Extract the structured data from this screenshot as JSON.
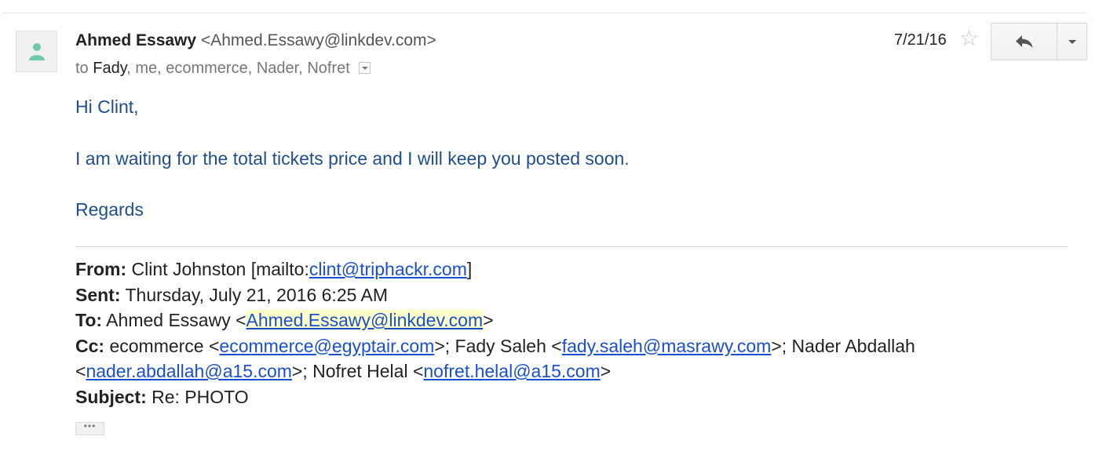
{
  "sender": {
    "name": "Ahmed Essawy",
    "email": "<Ahmed.Essawy@linkdev.com>"
  },
  "recipients": {
    "prefix": "to",
    "first": "Fady",
    "rest": ", me, ecommerce, Nader, Nofret"
  },
  "date": "7/21/16",
  "icons": {
    "avatar": "person-icon",
    "star": "star-icon",
    "reply": "reply-icon",
    "more": "chevron-down-icon"
  },
  "body": {
    "greeting": "Hi Clint,",
    "message": "I am waiting for the total tickets price and I will keep you posted soon.",
    "closing": "Regards"
  },
  "quote": {
    "from_label": "From:",
    "from_text": " Clint Johnston [mailto:",
    "from_link": "clint@triphackr.com",
    "from_end": "]",
    "sent_label": "Sent:",
    "sent_text": " Thursday, July 21, 2016 6:25 AM",
    "to_label": "To:",
    "to_text": " Ahmed Essawy <",
    "to_link": "Ahmed.Essawy@linkdev.com",
    "to_end": ">",
    "cc_label": "Cc:",
    "cc_t1": " ecommerce <",
    "cc_l1": "ecommerce@egyptair.com",
    "cc_t2": ">; Fady Saleh <",
    "cc_l2": "fady.saleh@masrawy.com",
    "cc_t3": ">; Nader Abdallah",
    "cc_t4": "<",
    "cc_l3": "nader.abdallah@a15.com",
    "cc_t5": ">; Nofret Helal <",
    "cc_l4": "nofret.helal@a15.com",
    "cc_t6": ">",
    "subject_label": "Subject:",
    "subject_text": " Re: PHOTO"
  },
  "ellipsis": "•••",
  "colors": {
    "body_text": "#1f4e8c",
    "link": "#1a4fd0",
    "highlight": "#ffffcc"
  }
}
